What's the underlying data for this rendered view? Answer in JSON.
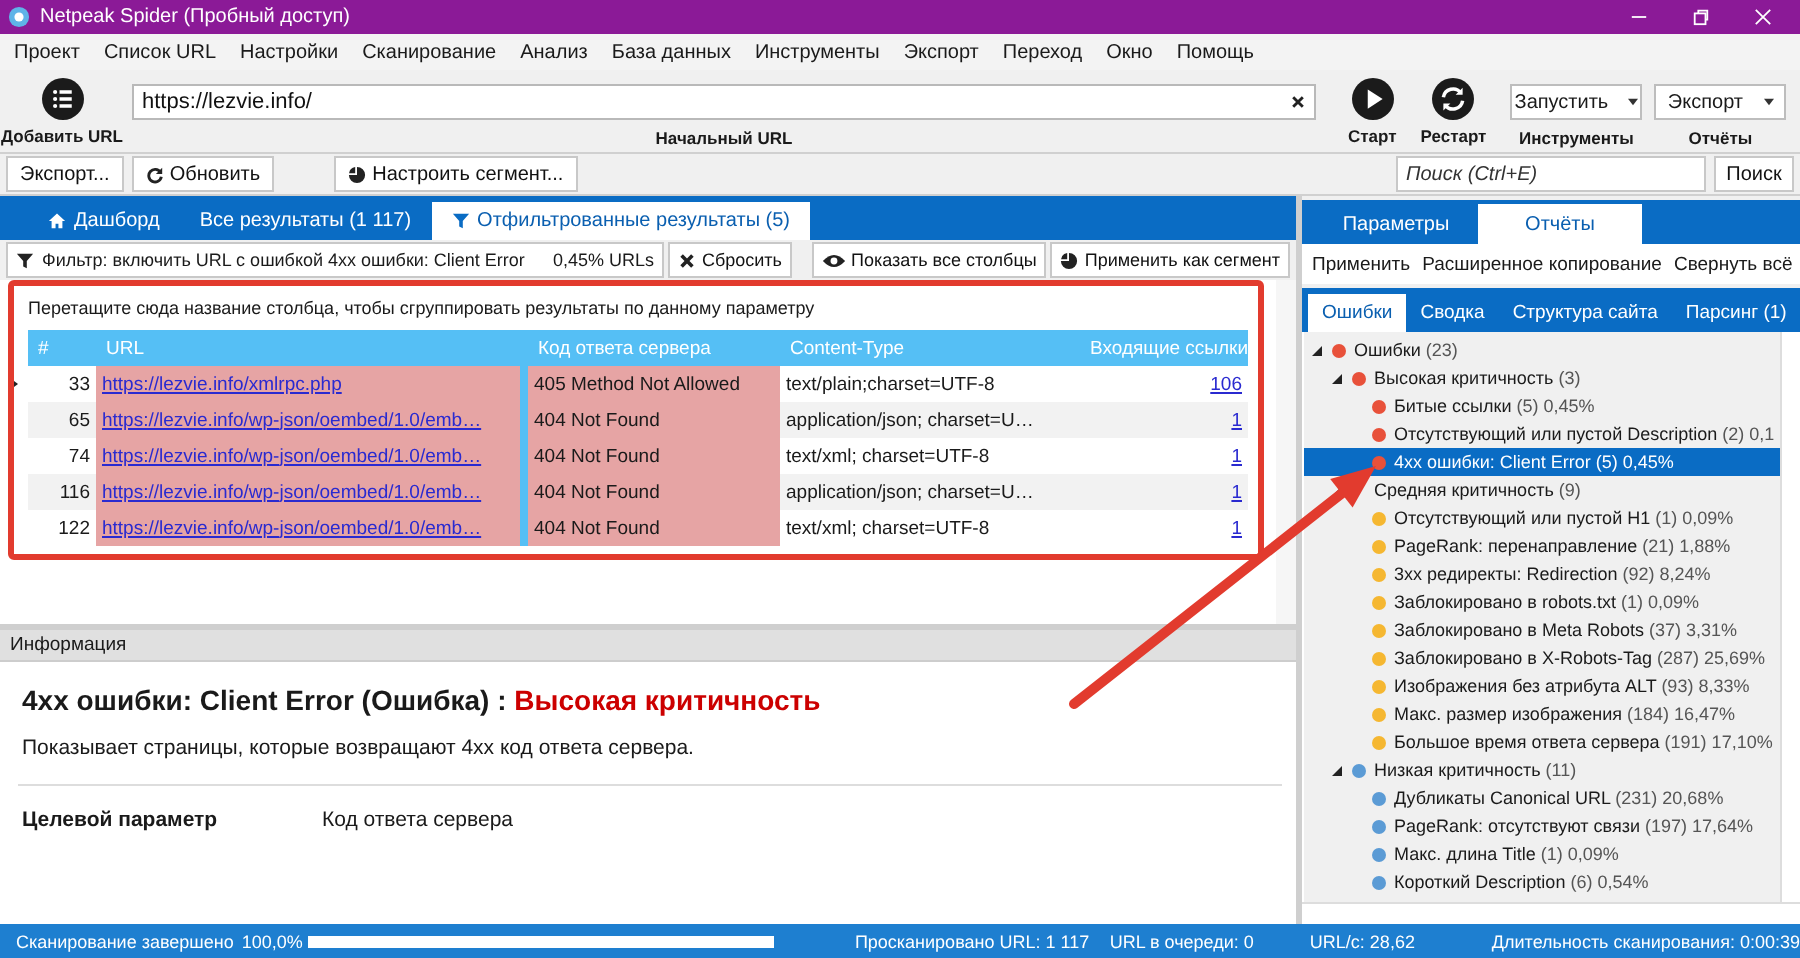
{
  "window": {
    "title": "Netpeak Spider (Пробный доступ)"
  },
  "menu": [
    "Проект",
    "Список URL",
    "Настройки",
    "Сканирование",
    "Анализ",
    "База данных",
    "Инструменты",
    "Экспорт",
    "Переход",
    "Окно",
    "Помощь"
  ],
  "toolbar": {
    "add_url": "Добавить URL",
    "url_value": "https://lezvie.info/",
    "url_caption": "Начальный URL",
    "start": "Старт",
    "restart": "Рестарт",
    "tools_dropdown": "Запустить",
    "tools_caption": "Инструменты",
    "reports_dropdown": "Экспорт",
    "reports_caption": "Отчёты"
  },
  "toolbar2": {
    "export": "Экспорт...",
    "refresh": "Обновить",
    "segment": "Настроить сегмент...",
    "search_placeholder": "Поиск (Ctrl+E)",
    "search_button": "Поиск"
  },
  "tabs": [
    {
      "label": "Дашборд",
      "kind": "home",
      "selected": false
    },
    {
      "label": "Все результаты (1 117)",
      "kind": "plain",
      "selected": false
    },
    {
      "label": "Отфильтрованные результаты (5)",
      "kind": "filter",
      "selected": true
    }
  ],
  "filter": {
    "text": "Фильтр: включить URL с ошибкой 4xx ошибки: Client Error",
    "share": "0,45% URLs",
    "reset": "Сбросить",
    "show_columns": "Показать все столбцы",
    "apply_segment": "Применить как сегмент"
  },
  "table": {
    "group_hint": "Перетащите сюда название столбца, чтобы сгруппировать результаты по данному параметру",
    "columns": [
      {
        "label": "#",
        "highlighted": false
      },
      {
        "label": "URL",
        "highlighted": true
      },
      {
        "label": "Код ответа сервера",
        "highlighted": true
      },
      {
        "label": "Content-Type",
        "highlighted": false
      },
      {
        "label": "Входящие ссылки",
        "highlighted": false
      }
    ],
    "rows": [
      {
        "num": "33",
        "url": "https://lezvie.info/xmlrpc.php",
        "code": "405 Method Not Allowed",
        "content_type": "text/plain;charset=UTF-8",
        "links": "106",
        "current": true
      },
      {
        "num": "65",
        "url": "https://lezvie.info/wp-json/oembed/1.0/emb…",
        "code": "404 Not Found",
        "content_type": "application/json; charset=U…",
        "links": "1",
        "current": false
      },
      {
        "num": "74",
        "url": "https://lezvie.info/wp-json/oembed/1.0/emb…",
        "code": "404 Not Found",
        "content_type": "text/xml; charset=UTF-8",
        "links": "1",
        "current": false
      },
      {
        "num": "116",
        "url": "https://lezvie.info/wp-json/oembed/1.0/emb…",
        "code": "404 Not Found",
        "content_type": "application/json; charset=U…",
        "links": "1",
        "current": false
      },
      {
        "num": "122",
        "url": "https://lezvie.info/wp-json/oembed/1.0/emb…",
        "code": "404 Not Found",
        "content_type": "text/xml; charset=UTF-8",
        "links": "1",
        "current": false
      }
    ]
  },
  "info": {
    "header": "Информация",
    "title": "4xx ошибки: Client Error (Ошибка) :",
    "severity": "Высокая критичность",
    "description": "Показывает страницы, которые возвращают 4xx код ответа сервера.",
    "param_label": "Целевой параметр",
    "param_value": "Код ответа сервера"
  },
  "side_tabs": [
    {
      "label": "Параметры",
      "selected": false
    },
    {
      "label": "Отчёты",
      "selected": true
    }
  ],
  "side_actions": [
    "Применить",
    "Расширенное копирование",
    "Свернуть всё"
  ],
  "report_tabs": [
    {
      "label": "Ошибки",
      "selected": true
    },
    {
      "label": "Сводка",
      "selected": false
    },
    {
      "label": "Структура сайта",
      "selected": false
    },
    {
      "label": "Парсинг (1)",
      "selected": false
    }
  ],
  "tree": {
    "items": [
      {
        "label": "Ошибки",
        "stats": "(23)",
        "color": "#e8513a",
        "selected": false,
        "expanded": true,
        "children": [
          {
            "label": "Высокая критичность",
            "stats": "(3)",
            "color": "#e8513a",
            "selected": false,
            "expanded": true,
            "children": [
              {
                "label": "Битые ссылки",
                "stats": "(5) 0,45%",
                "color": "#e8513a",
                "selected": false
              },
              {
                "label": "Отсутствующий или пустой Description",
                "stats": "(2) 0,1",
                "color": "#e8513a",
                "selected": false
              },
              {
                "label": "4xx ошибки: Client Error",
                "stats": "(5) 0,45%",
                "color": "#e8513a",
                "selected": true
              }
            ]
          },
          {
            "label": "Средняя критичность",
            "stats": "(9)",
            "selected": false,
            "expanded": true,
            "children": [
              {
                "label": "Отсутствующий или пустой H1",
                "stats": "(1) 0,09%",
                "color": "#f5b731",
                "selected": false
              },
              {
                "label": "PageRank: перенаправление",
                "stats": "(21) 1,88%",
                "color": "#f5b731",
                "selected": false
              },
              {
                "label": "3xx редиректы: Redirection",
                "stats": "(92) 8,24%",
                "color": "#f5b731",
                "selected": false
              },
              {
                "label": "Заблокировано в robots.txt",
                "stats": "(1) 0,09%",
                "color": "#f5b731",
                "selected": false
              },
              {
                "label": "Заблокировано в Meta Robots",
                "stats": "(37) 3,31%",
                "color": "#f5b731",
                "selected": false
              },
              {
                "label": "Заблокировано в X-Robots-Tag",
                "stats": "(287) 25,69%",
                "color": "#f5b731",
                "selected": false
              },
              {
                "label": "Изображения без атрибута ALT",
                "stats": "(93) 8,33%",
                "color": "#f5b731",
                "selected": false
              },
              {
                "label": "Макс. размер изображения",
                "stats": "(184) 16,47%",
                "color": "#f5b731",
                "selected": false
              },
              {
                "label": "Большое время ответа сервера",
                "stats": "(191) 17,10%",
                "color": "#f5b731",
                "selected": false
              }
            ]
          },
          {
            "label": "Низкая критичность",
            "stats": "(11)",
            "color": "#5b9bd5",
            "selected": false,
            "expanded": true,
            "children": [
              {
                "label": "Дубликаты Canonical URL",
                "stats": "(231) 20,68%",
                "color": "#5b9bd5",
                "selected": false
              },
              {
                "label": "PageRank: отсутствуют связи",
                "stats": "(197) 17,64%",
                "color": "#5b9bd5",
                "selected": false
              },
              {
                "label": "Макс. длина Title",
                "stats": "(1) 0,09%",
                "color": "#5b9bd5",
                "selected": false
              },
              {
                "label": "Короткий Description",
                "stats": "(6) 0,54%",
                "color": "#5b9bd5",
                "selected": false
              }
            ]
          }
        ]
      }
    ]
  },
  "status_bar": {
    "state": "Сканирование завершено",
    "percent": "100,0%",
    "level": 1,
    "crawled": "Просканировано URL: 1 117",
    "queue": "URL в очереди: 0",
    "speed": "URL/с: 28,62",
    "duration": "Длительность сканирования: 0:00:39"
  }
}
